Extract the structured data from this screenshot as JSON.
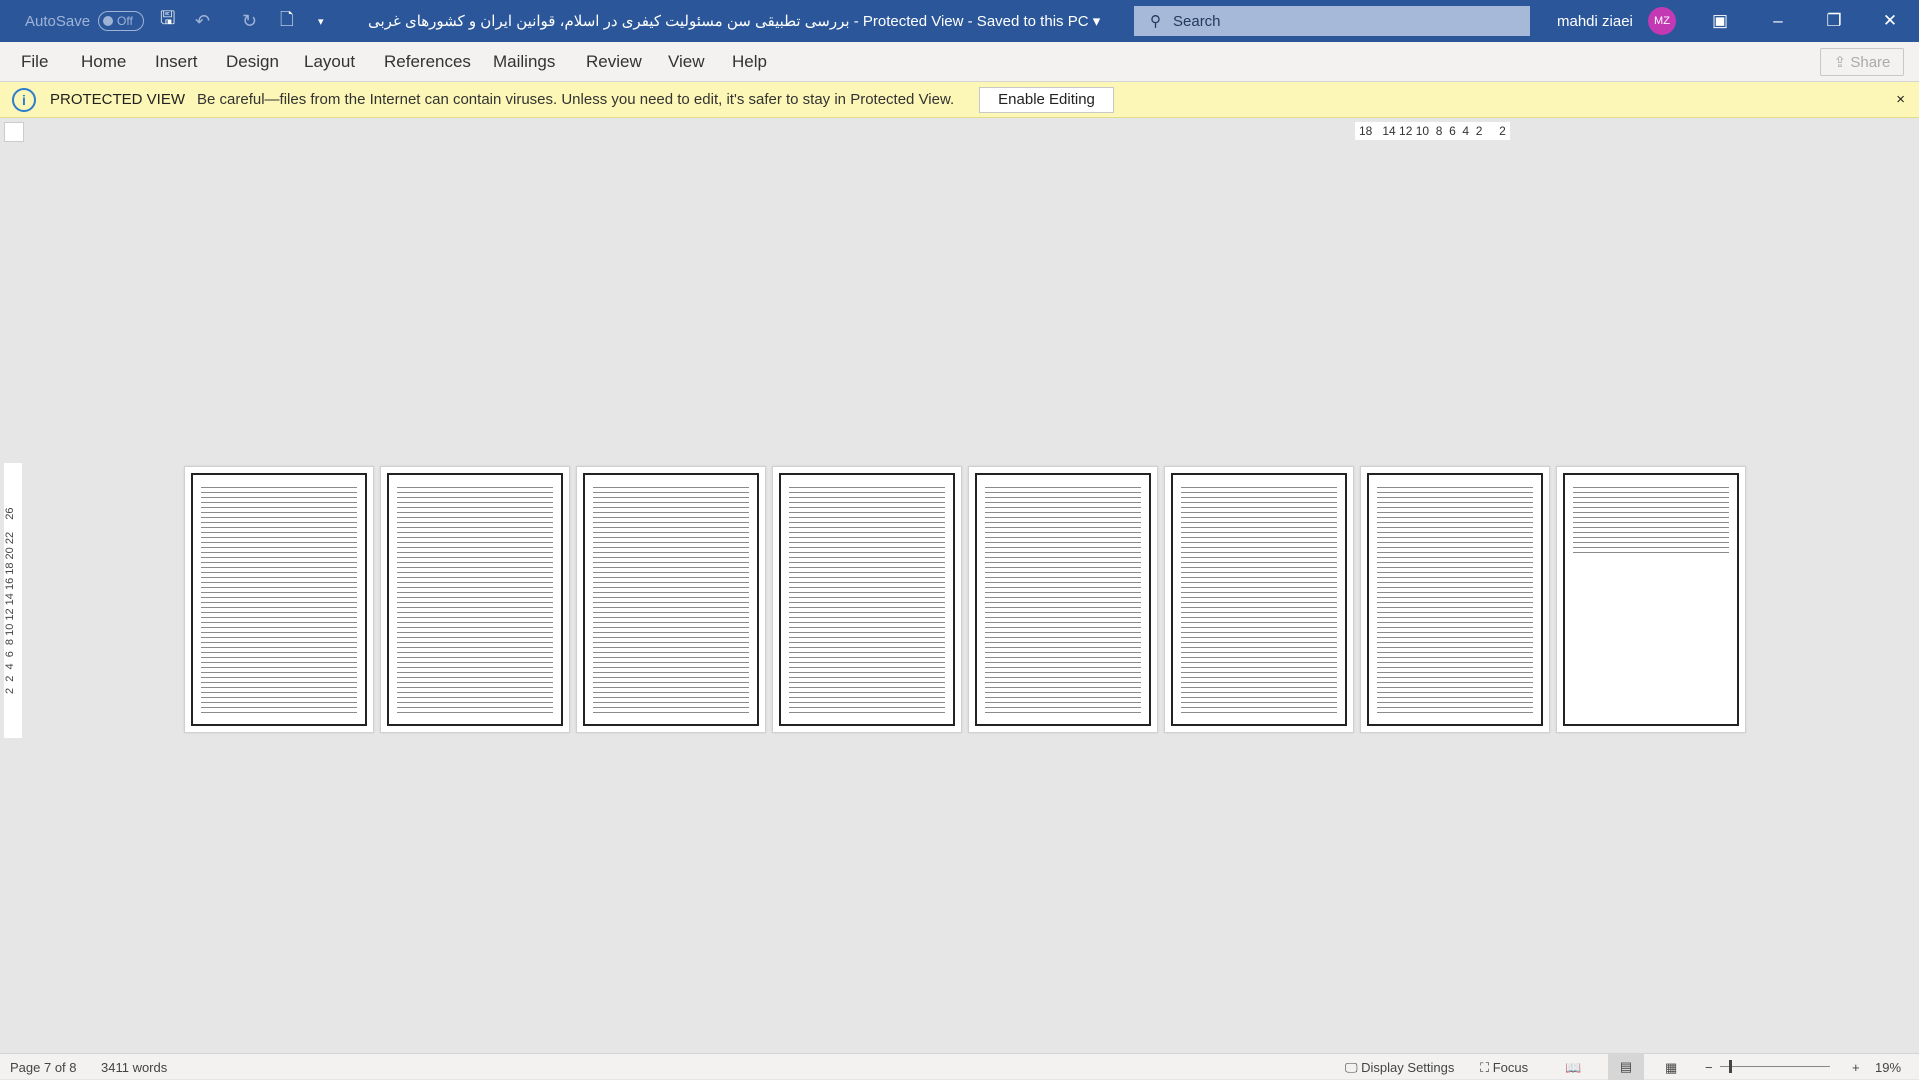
{
  "titlebar": {
    "autosave_label": "AutoSave",
    "autosave_state": "Off",
    "document_title": "بررسی تطبیقی سن مسئولیت کیفری در اسلام، قوانین ایران و کشورهای غربی",
    "view_state": "- Protected View - Saved to this PC ▾",
    "search_placeholder": "Search",
    "user_name": "mahdi ziaei",
    "user_initials": "MZ"
  },
  "ribbon": {
    "tabs": [
      "File",
      "Home",
      "Insert",
      "Design",
      "Layout",
      "References",
      "Mailings",
      "Review",
      "View",
      "Help"
    ],
    "share_label": "Share"
  },
  "protected_view": {
    "label": "PROTECTED VIEW",
    "message": "Be careful—files from the Internet can contain viruses. Unless you need to edit, it's safer to stay in Protected View.",
    "enable_button": "Enable Editing",
    "close": "×"
  },
  "ruler": {
    "horizontal": "18   14 12 10  8  6  4  2     2",
    "vertical": "2  2  4  6  8 10 12 14 16 18 20 22    26"
  },
  "pages_count": 8,
  "statusbar": {
    "page": "Page 7 of 8",
    "words": "3411 words",
    "display_settings": "Display Settings",
    "focus": "Focus",
    "zoom": "19%"
  }
}
